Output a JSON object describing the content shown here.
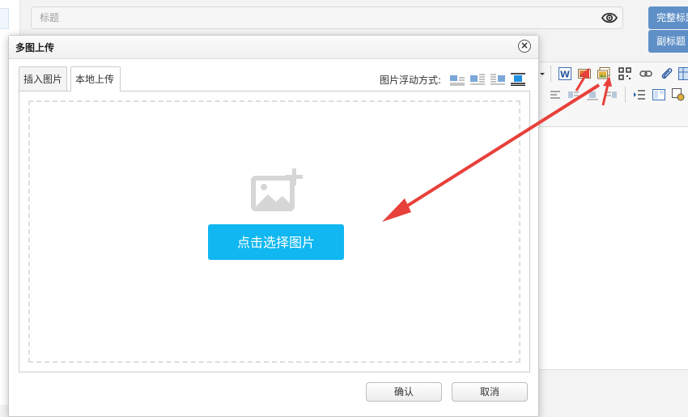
{
  "editor": {
    "title_placeholder": "标题",
    "full_title_button": "完整标题",
    "subtitle_button": "副标题"
  },
  "dialog": {
    "title": "多图上传",
    "tabs": [
      {
        "label": "插入图片",
        "active": false
      },
      {
        "label": "本地上传",
        "active": true
      }
    ],
    "float_label": "图片浮动方式:",
    "float_options": [
      "float-none-icon",
      "float-left-icon",
      "float-right-icon",
      "float-center-icon"
    ],
    "choose_button": "点击选择图片",
    "confirm_button": "确认",
    "cancel_button": "取消"
  },
  "colors": {
    "primary": "#10b7f0",
    "annotation_arrow": "#e8403a",
    "side_button": "#5f8fc7"
  }
}
